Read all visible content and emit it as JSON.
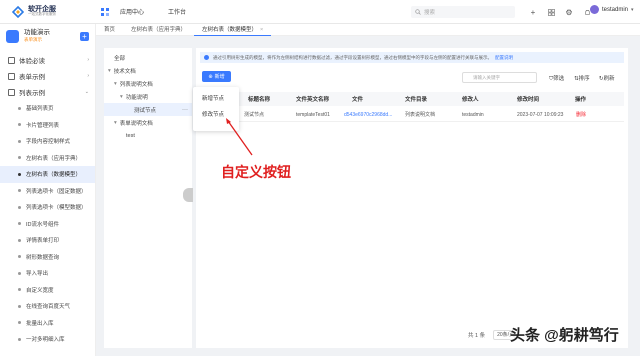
{
  "brand": {
    "title": "软开企服",
    "subtitle": "一站式数字化服务"
  },
  "top_nav": [
    {
      "label": "应用中心"
    },
    {
      "label": "工作台"
    }
  ],
  "search": {
    "placeholder": "搜索"
  },
  "top_icons": [
    "plus-icon",
    "apps-grid-icon",
    "settings-icon",
    "bell-icon"
  ],
  "user": {
    "name": "testadmin"
  },
  "app": {
    "name": "功能演示",
    "tag": "表单演示"
  },
  "sidebar": {
    "groups": [
      {
        "label": "体验必读"
      },
      {
        "label": "表单示例"
      },
      {
        "label": "列表示例"
      }
    ],
    "items": [
      {
        "label": "基础列表页"
      },
      {
        "label": "卡片管理列表"
      },
      {
        "label": "字段内容控制样式"
      },
      {
        "label": "左树右表（应用字典）"
      },
      {
        "label": "左树右表（数据模型）"
      },
      {
        "label": "列表选项卡（固定数据）"
      },
      {
        "label": "列表选项卡（模型数据）"
      },
      {
        "label": "ID流水号组件"
      },
      {
        "label": "详情表单打印"
      },
      {
        "label": "树形数据查询"
      },
      {
        "label": "导入导出"
      },
      {
        "label": "自定义宽度"
      },
      {
        "label": "在线查询百度天气"
      },
      {
        "label": "批量出入库"
      },
      {
        "label": "一对多明细入库"
      }
    ]
  },
  "tabs": [
    {
      "label": "首页"
    },
    {
      "label": "左树右表（应用字典）"
    },
    {
      "label": "左树右表（数据模型）"
    }
  ],
  "tree": {
    "nodes": [
      {
        "label": "全部"
      },
      {
        "label": "技术文档"
      },
      {
        "label": "列表说明文档"
      },
      {
        "label": "功能说明"
      },
      {
        "label": "测试节点"
      },
      {
        "label": "表单说明文档"
      },
      {
        "label": "test"
      }
    ]
  },
  "notice": {
    "text": "通过引用树形生成的模型，将作为左侧树结构进行数据过滤，通过字段设置树形模型，通过右侧模型中的字段与左侧的配置进行关联与展示。",
    "link": "配置说明"
  },
  "toolbar": {
    "new_label": "新增",
    "filter_placeholder": "请输入关键字",
    "filter_label": "筛选",
    "sort_label": "排序",
    "refresh_label": "刷新"
  },
  "table": {
    "headers": [
      "标题名称",
      "文件英文名称",
      "文件",
      "文件目录",
      "修改人",
      "修改时间",
      "操作"
    ],
    "rows": [
      {
        "title": "测试节点",
        "en_name": "templateTest01",
        "file": "d543e6970c2968dd...",
        "dir": "列表说明文档",
        "modifier": "testadmin",
        "time": "2023-07-07 10:09:23",
        "action": "删除"
      }
    ]
  },
  "pager": {
    "total": "共 1 条",
    "page_size": "20条/页"
  },
  "dropdown": {
    "items": [
      {
        "label": "新增节点"
      },
      {
        "label": "修改节点"
      }
    ]
  },
  "annotation": {
    "text": "自定义按钮"
  },
  "watermark": {
    "text": "头条 @躬耕笃行"
  },
  "colors": {
    "primary": "#3a7afe",
    "annotation": "#e02020",
    "danger": "#f5222d",
    "active_bg": "#e8effd"
  }
}
